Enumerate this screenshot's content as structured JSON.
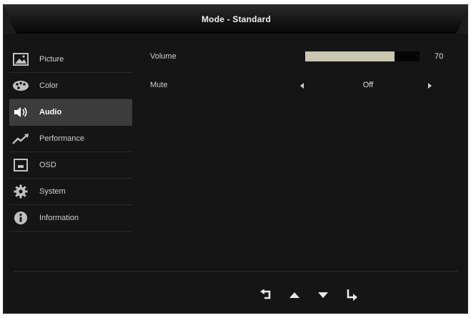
{
  "header": {
    "title": "Mode - Standard"
  },
  "sidebar": {
    "items": [
      {
        "label": "Picture",
        "icon": "picture-icon",
        "active": false
      },
      {
        "label": "Color",
        "icon": "palette-icon",
        "active": false
      },
      {
        "label": "Audio",
        "icon": "speaker-icon",
        "active": true
      },
      {
        "label": "Performance",
        "icon": "performance-icon",
        "active": false
      },
      {
        "label": "OSD",
        "icon": "osd-icon",
        "active": false
      },
      {
        "label": "System",
        "icon": "gear-icon",
        "active": false
      },
      {
        "label": "Information",
        "icon": "info-icon",
        "active": false
      }
    ]
  },
  "audio": {
    "volume": {
      "label": "Volume",
      "value": "70",
      "percent": 78
    },
    "mute": {
      "label": "Mute",
      "value": "Off"
    }
  },
  "nav": {
    "buttons": [
      "back-icon",
      "up-icon",
      "down-icon",
      "enter-icon"
    ]
  },
  "colors": {
    "background": "#151515",
    "active_item": "#3c3c3c",
    "volume_fill": "#c9c7b0",
    "text": "#cfcfcf"
  }
}
